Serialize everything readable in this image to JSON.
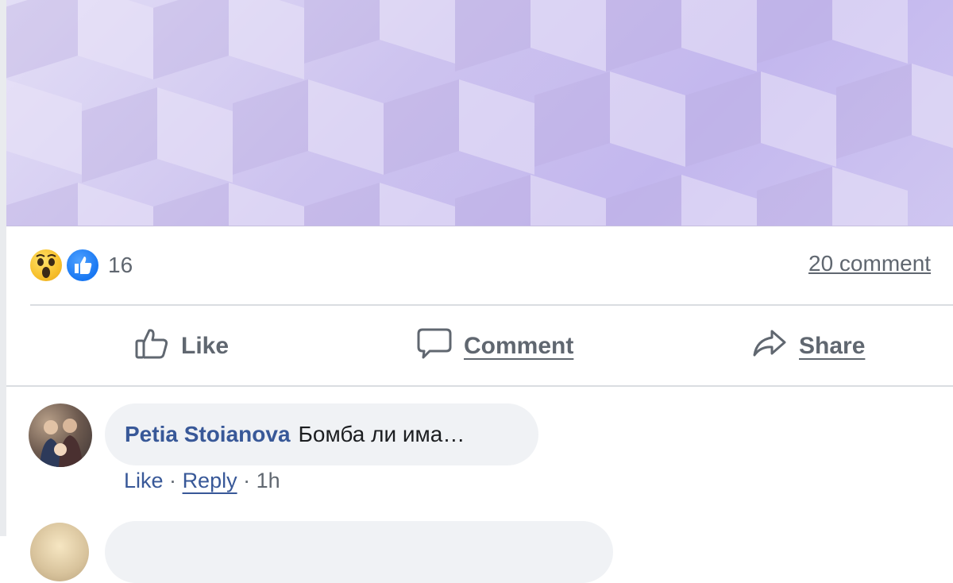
{
  "post": {
    "reactions": {
      "icons": [
        "wow-emoji-icon",
        "like-thumb-icon"
      ],
      "count": "16",
      "comments_link": "20 comment"
    },
    "actions": {
      "like_label": "Like",
      "comment_label": "Comment",
      "share_label": "Share"
    }
  },
  "comments": [
    {
      "author": "Petia Stoianova",
      "text": "Бомба ли има…",
      "like_label": "Like",
      "separator": "·",
      "reply_label": "Reply",
      "time": "1h"
    }
  ],
  "colors": {
    "author_link": "#385898",
    "muted_text": "#606770",
    "bubble_bg": "#f0f2f5",
    "like_blue": "#1877f2",
    "image_tint": "#c3b7ee"
  }
}
